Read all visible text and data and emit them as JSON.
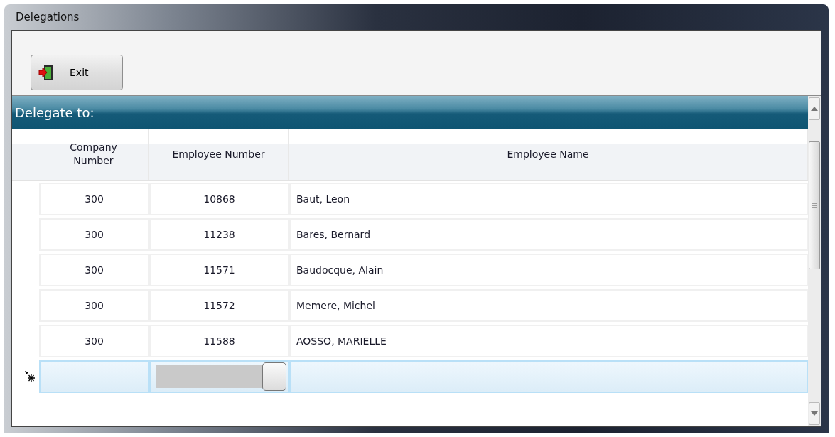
{
  "window": {
    "title": "Delegations"
  },
  "toolbar": {
    "buttons": [
      {
        "label": "Exit"
      }
    ]
  },
  "group": {
    "title": "Delegate to:"
  },
  "table": {
    "columns": [
      {
        "label": "Company\nNumber"
      },
      {
        "label": "Employee Number"
      },
      {
        "label": "Employee Name"
      }
    ],
    "rows": [
      {
        "cells": [
          "300",
          "10868",
          "Baut, Leon"
        ],
        "selected": false
      },
      {
        "cells": [
          "300",
          "11238",
          "Bares, Bernard"
        ],
        "selected": false
      },
      {
        "cells": [
          "300",
          "11571",
          "Baudocque, Alain"
        ],
        "selected": false
      },
      {
        "cells": [
          "300",
          "11572",
          "Memere, Michel"
        ],
        "selected": false
      },
      {
        "cells": [
          "300",
          "11588",
          "AOSSO, MARIELLE"
        ],
        "selected": false
      }
    ],
    "new_row": {
      "selected": true
    }
  }
}
